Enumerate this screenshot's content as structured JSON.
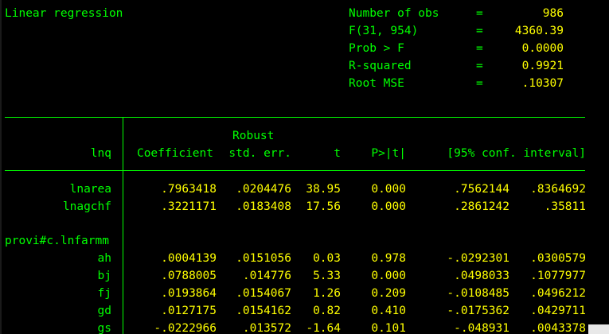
{
  "title": "Linear regression",
  "stats": [
    {
      "label": "Number of obs",
      "eq": "=",
      "value": "986"
    },
    {
      "label": "F(31, 954)",
      "eq": "=",
      "value": "4360.39"
    },
    {
      "label": "Prob > F",
      "eq": "=",
      "value": "0.0000"
    },
    {
      "label": "R-squared",
      "eq": "=",
      "value": "0.9921"
    },
    {
      "label": "Root MSE",
      "eq": "=",
      "value": ".10307"
    }
  ],
  "header": {
    "robust": "Robust",
    "depvar": "lnq",
    "cols": [
      "Coefficient",
      "std. err.",
      "t",
      "P>|t|",
      "[95% conf. interval]"
    ]
  },
  "rows": [
    {
      "name": "lnarea",
      "coef": ".7963418",
      "se": ".0204476",
      "t": "38.95",
      "p": "0.000",
      "lo": ".7562144",
      "hi": ".8364692"
    },
    {
      "name": "lnagchf",
      "coef": ".3221171",
      "se": ".0183408",
      "t": "17.56",
      "p": "0.000",
      "lo": ".2861242",
      "hi": ".35811"
    }
  ],
  "group_label": "provi#c.lnfarmm",
  "group_rows": [
    {
      "name": "ah",
      "coef": ".0004139",
      "se": ".0151056",
      "t": "0.03",
      "p": "0.978",
      "lo": "-.0292301",
      "hi": ".0300579"
    },
    {
      "name": "bj",
      "coef": ".0788005",
      "se": ".014776",
      "t": "5.33",
      "p": "0.000",
      "lo": ".0498033",
      "hi": ".1077977"
    },
    {
      "name": "fj",
      "coef": ".0193864",
      "se": ".0154067",
      "t": "1.26",
      "p": "0.209",
      "lo": "-.0108485",
      "hi": ".0496212"
    },
    {
      "name": "gd",
      "coef": ".0127175",
      "se": ".0154162",
      "t": "0.82",
      "p": "0.410",
      "lo": "-.0175362",
      "hi": ".0429711"
    },
    {
      "name": "gs",
      "coef": "-.0222966",
      "se": ".013572",
      "t": "-1.64",
      "p": "0.101",
      "lo": "-.048931",
      "hi": ".0043378"
    }
  ],
  "colors": {
    "background": "#000000",
    "label_green": "#00ff00",
    "value_yellow": "#ffff00"
  }
}
